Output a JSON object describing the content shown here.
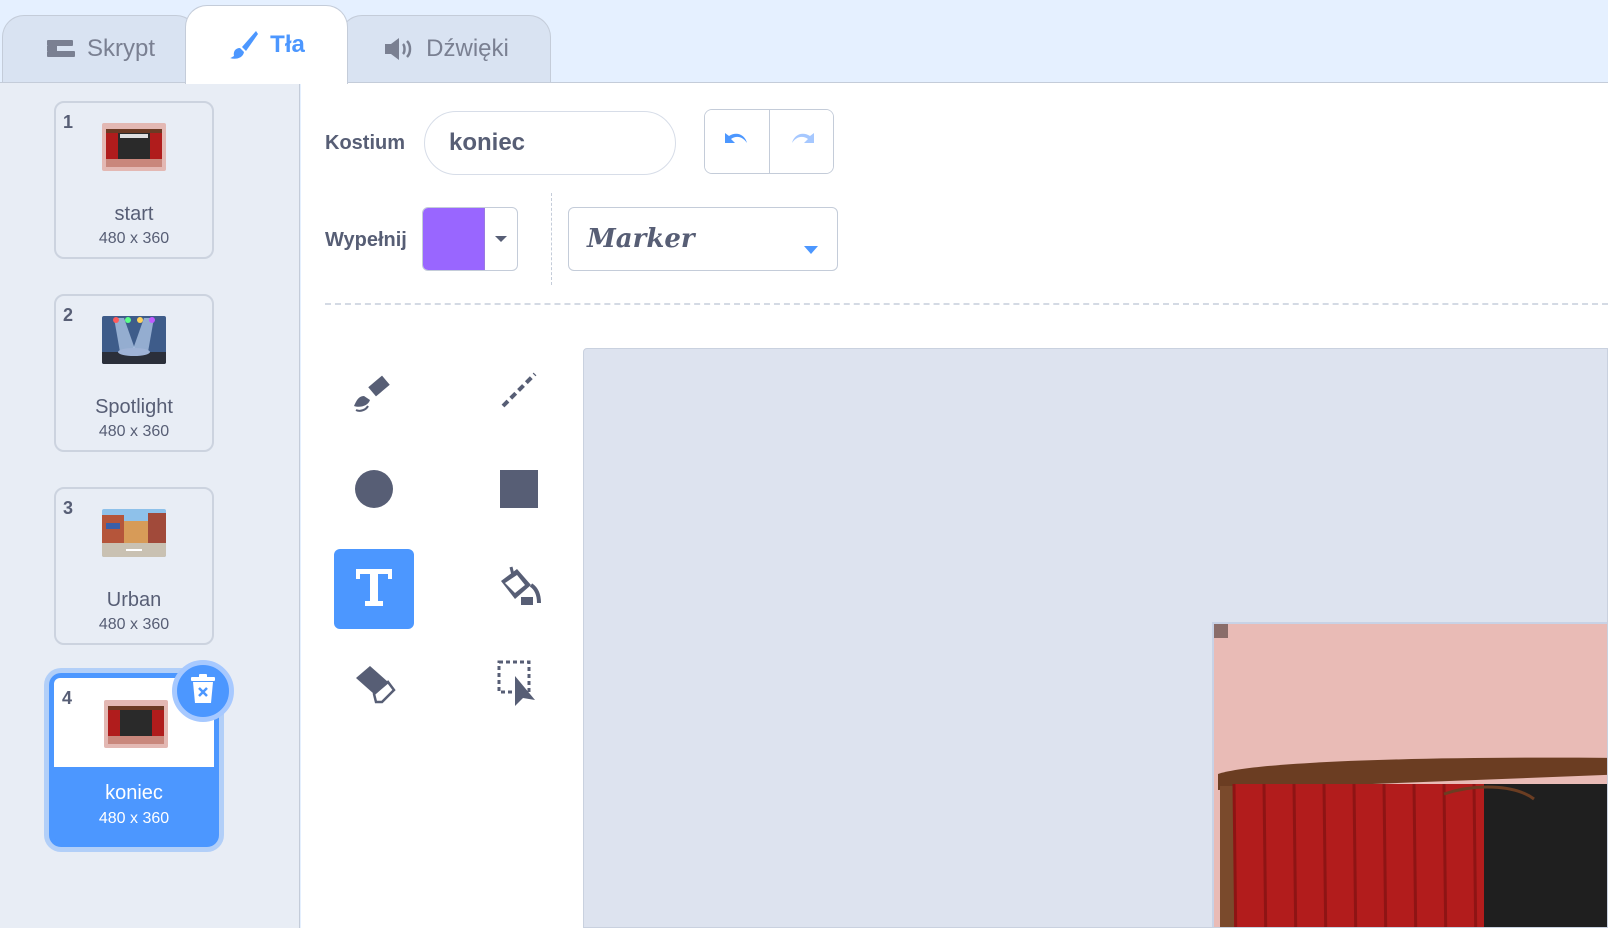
{
  "tabs": [
    {
      "label": "Skrypt",
      "icon": "code-icon"
    },
    {
      "label": "Tła",
      "icon": "brush-icon",
      "active": true
    },
    {
      "label": "Dźwięki",
      "icon": "speaker-icon"
    }
  ],
  "costumes": [
    {
      "number": "1",
      "name": "start",
      "size": "480 x 360"
    },
    {
      "number": "2",
      "name": "Spotlight",
      "size": "480 x 360"
    },
    {
      "number": "3",
      "name": "Urban",
      "size": "480 x 360"
    },
    {
      "number": "4",
      "name": "koniec",
      "size": "480 x 360",
      "selected": true
    }
  ],
  "editor": {
    "costume_label": "Kostium",
    "costume_name": "koniec",
    "fill_label": "Wypełnij",
    "fill_color": "#9966ff",
    "font": "Marker",
    "active_tool": "text-tool"
  },
  "colors": {
    "accent": "#4c97ff",
    "text": "#575e75",
    "icon": "#575e75"
  }
}
